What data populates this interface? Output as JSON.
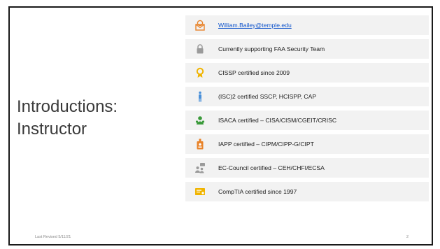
{
  "slide": {
    "title_line1": "Introductions:",
    "title_line2": "Instructor",
    "footer_date": "Last Revised 5/11/21",
    "page_number": "2"
  },
  "items": [
    {
      "icon": "envelope-badge-icon",
      "text": "William.Bailey@temple.edu",
      "link": true,
      "color": "#e8832a"
    },
    {
      "icon": "lock-icon",
      "text": "Currently supporting FAA Security Team",
      "link": false,
      "color": "#9a9a9a"
    },
    {
      "icon": "award-ribbon-icon",
      "text": "CISSP certified since 2009",
      "link": false,
      "color": "#f0b400"
    },
    {
      "icon": "person-standing-icon",
      "text": "(ISC)2 certified SSCP, HCISPP, CAP",
      "link": false,
      "color": "#4a90d9"
    },
    {
      "icon": "user-group-icon",
      "text": "ISACA certified – CISA/CISM/CGEIT/CRISC",
      "link": false,
      "color": "#3a9a3a"
    },
    {
      "icon": "id-badge-icon",
      "text": "IAPP certified – CIPM/CIPP-G/CIPT",
      "link": false,
      "color": "#e8832a"
    },
    {
      "icon": "people-chat-icon",
      "text": "EC-Council certified – CEH/CHFI/ECSA",
      "link": false,
      "color": "#9a9a9a"
    },
    {
      "icon": "certificate-icon",
      "text": "CompTIA certified since 1997",
      "link": false,
      "color": "#f0b400"
    }
  ]
}
